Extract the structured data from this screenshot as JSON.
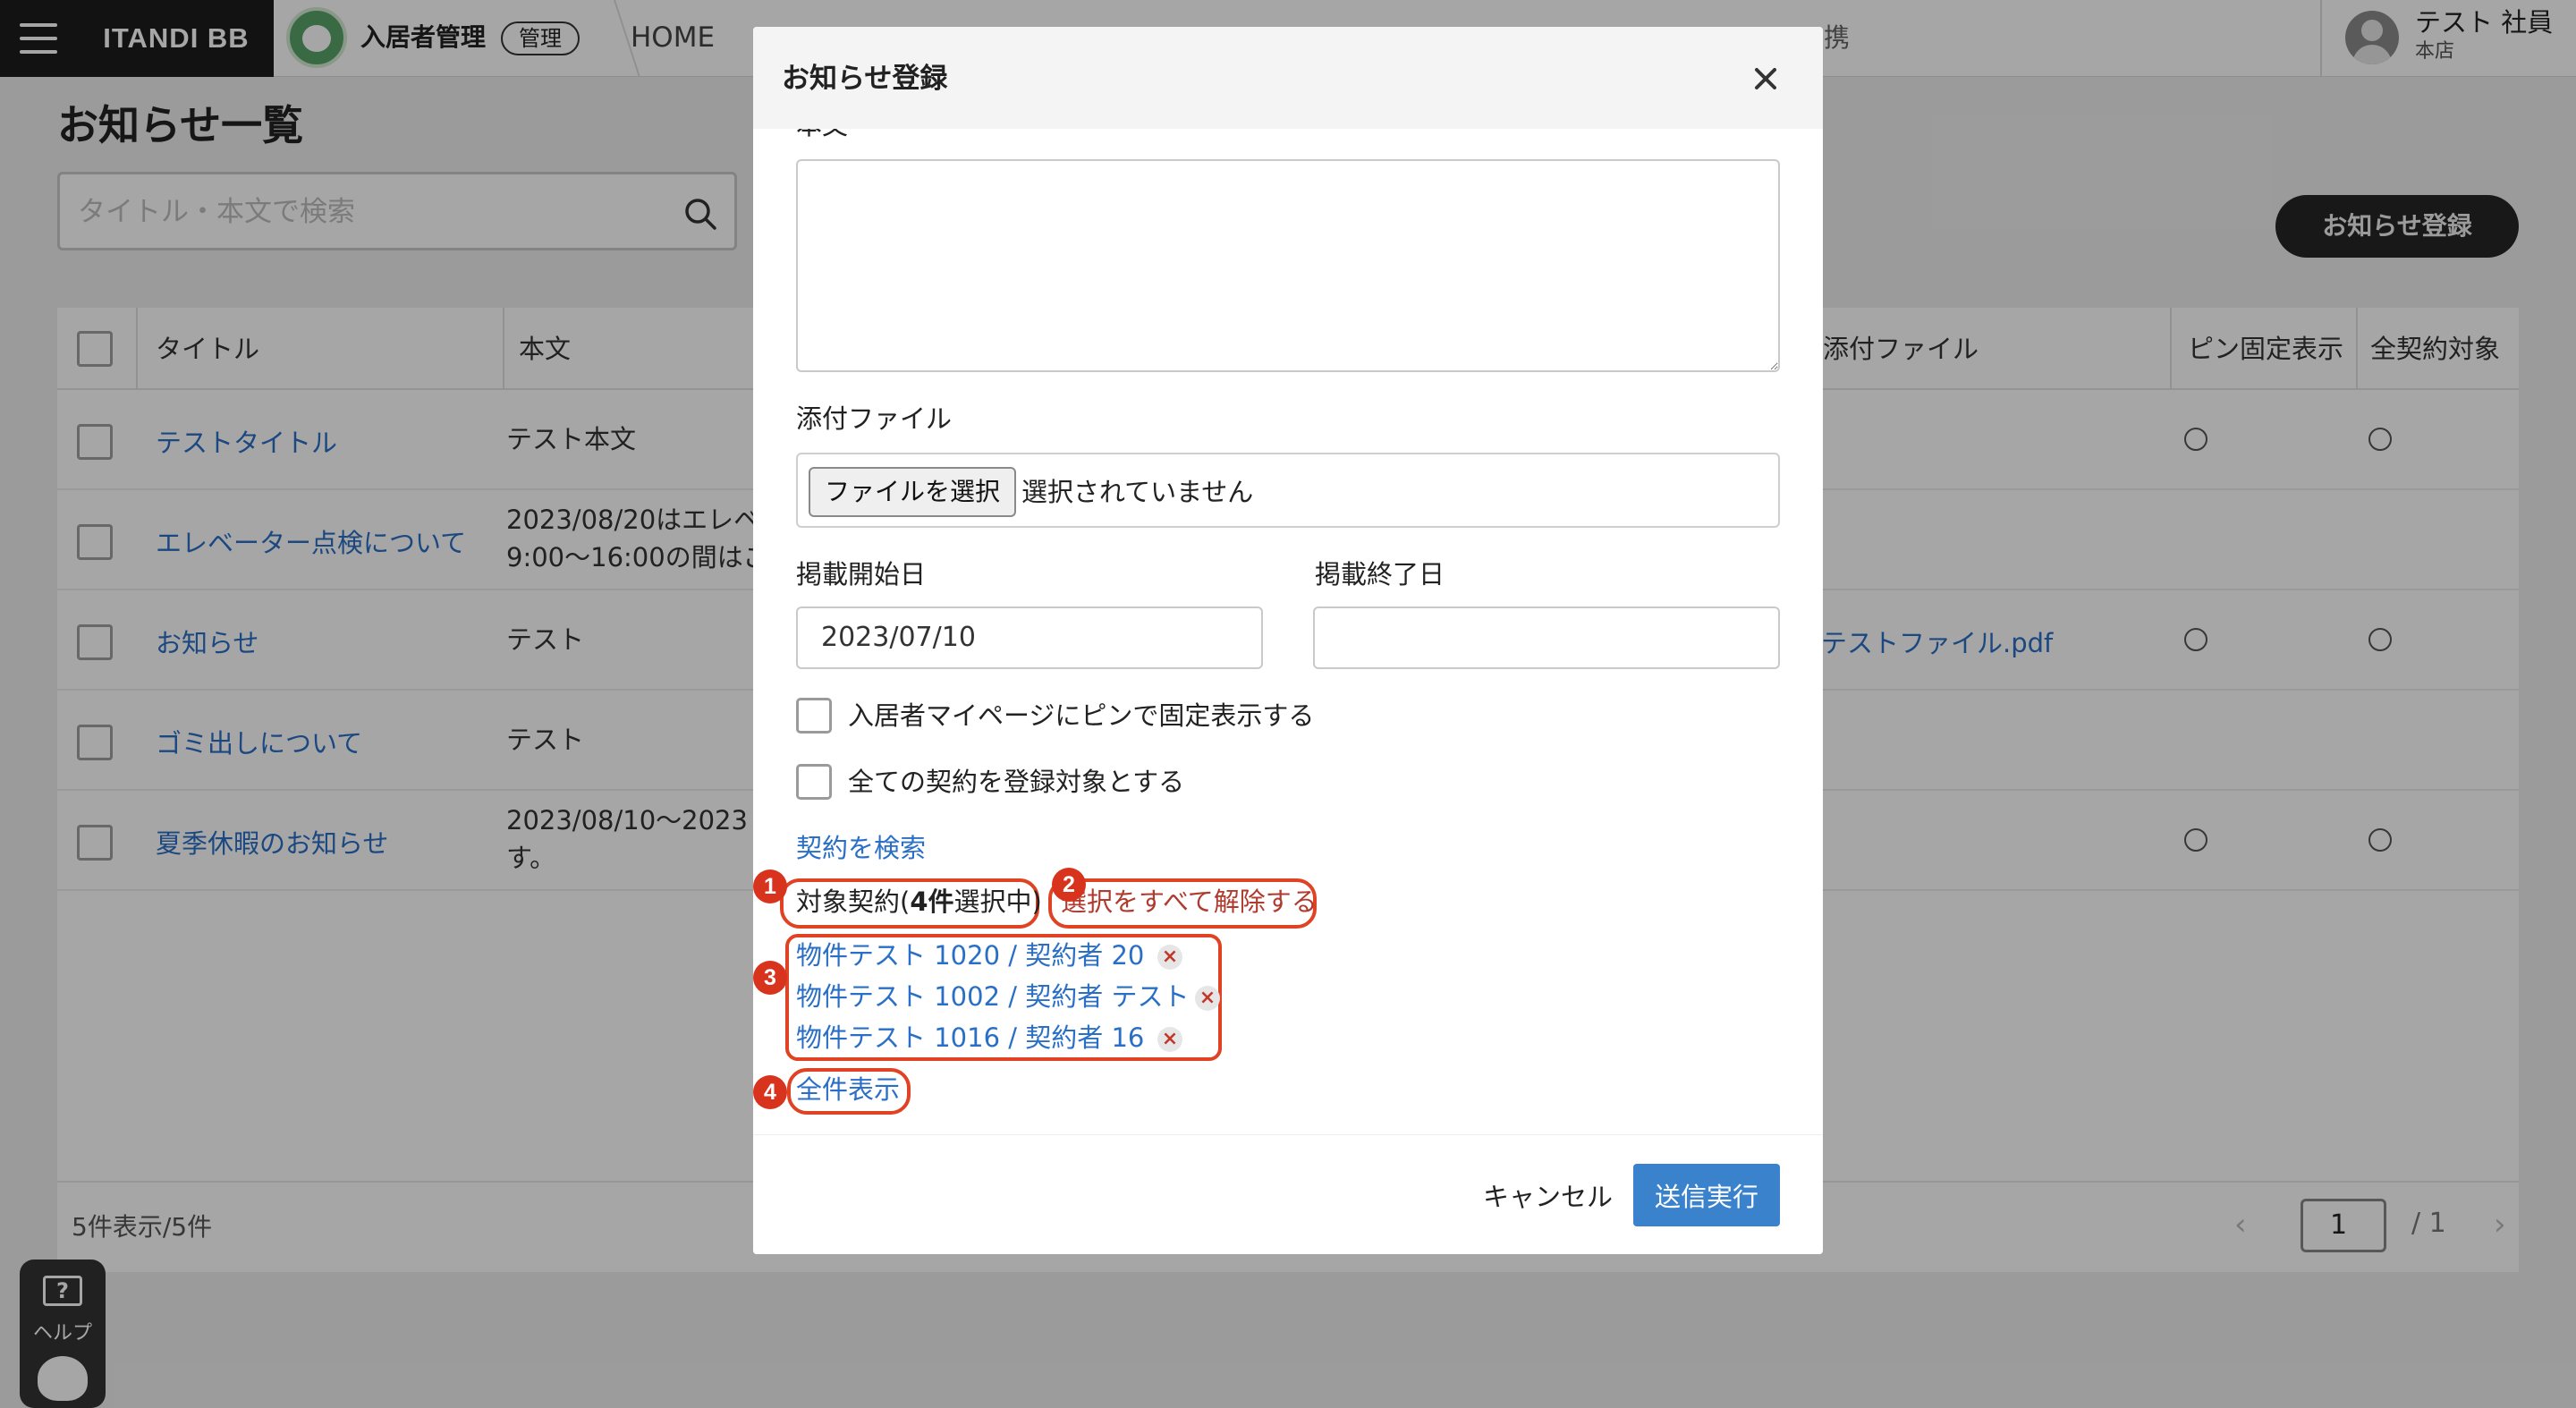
{
  "app": {
    "logo": "ITANDI BB",
    "module": "入居者管理",
    "badge": "管理",
    "nav_home": "HOME",
    "nav_faded": "一携"
  },
  "user": {
    "name": "テスト 社員",
    "branch": "本店"
  },
  "page": {
    "title": "お知らせ一覧",
    "search_placeholder": "タイトル・本文で検索",
    "register_button": "お知らせ登録"
  },
  "table": {
    "headers": {
      "title": "タイトル",
      "body": "本文",
      "attachment": "添付ファイル",
      "pinned": "ピン固定表示",
      "all_contracts": "全契約対象"
    },
    "rows": [
      {
        "title": "テストタイトル",
        "body1": "テスト本文",
        "body2": "",
        "attachment": ""
      },
      {
        "title": "エレベーター点検について",
        "body1": "2023/08/20はエレベ",
        "body2": "9:00～16:00の間はご",
        "attachment": ""
      },
      {
        "title": "お知らせ",
        "body1": "テスト",
        "body2": "",
        "attachment": "テストファイル.pdf"
      },
      {
        "title": "ゴミ出しについて",
        "body1": "テスト",
        "body2": "",
        "attachment": ""
      },
      {
        "title": "夏季休暇のお知らせ",
        "body1": "2023/08/10～2023",
        "body2": "す。",
        "attachment": ""
      }
    ],
    "count": "5件表示/5件",
    "page_current": "1",
    "page_total": "/ 1"
  },
  "help": {
    "label": "ヘルプ"
  },
  "modal": {
    "title": "お知らせ登録",
    "body_label": "本文",
    "attachment_label": "添付ファイル",
    "file_button": "ファイルを選択",
    "file_status": "選択されていません",
    "start_label": "掲載開始日",
    "start_value": "2023/07/10",
    "end_label": "掲載終了日",
    "end_value": "",
    "pin_check": "入居者マイページにピンで固定表示する",
    "all_check": "全ての契約を登録対象とする",
    "search_contracts": "契約を検索",
    "target_prefix": "対象契約(",
    "target_count": "4件",
    "target_suffix": "選択中)",
    "clear_all": "選択をすべて解除する",
    "contracts": [
      "物件テスト 1020 / 契約者 20",
      "物件テスト 1002 / 契約者 テスト",
      "物件テスト 1016 / 契約者 16"
    ],
    "show_all": "全件表示",
    "cancel": "キャンセル",
    "submit": "送信実行",
    "annotations": [
      "1",
      "2",
      "3",
      "4"
    ]
  },
  "colors": {
    "link": "#2a6fc6",
    "primary": "#3a82cc",
    "annotation": "#e04324",
    "dark": "#1d1d1d"
  }
}
